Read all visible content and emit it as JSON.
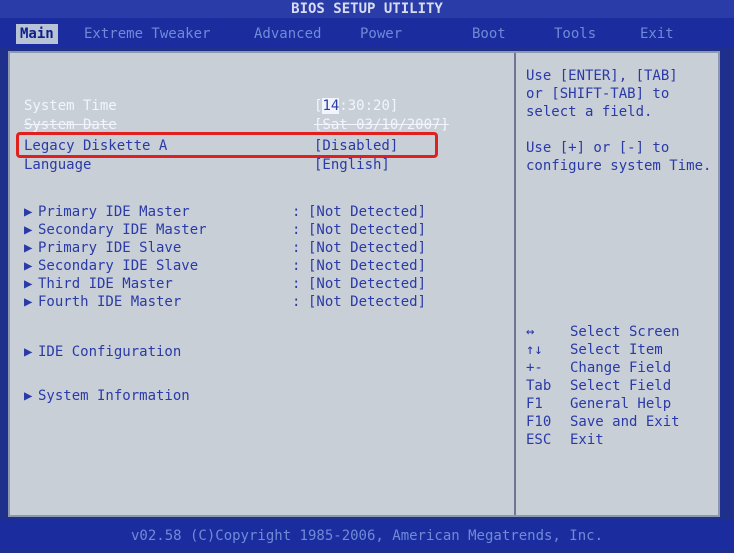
{
  "title": "BIOS SETUP UTILITY",
  "menu": [
    {
      "label": "Main"
    },
    {
      "label": "Extreme Tweaker"
    },
    {
      "label": "Advanced"
    },
    {
      "label": "Power"
    },
    {
      "label": "Boot"
    },
    {
      "label": "Tools"
    },
    {
      "label": "Exit"
    }
  ],
  "settings": [
    {
      "label": "System Time",
      "value_prefix": "[",
      "value_highlight": "14",
      "value_suffix": ":30:20]"
    },
    {
      "label": "System Date",
      "value": "[Sat 03/10/2007]"
    },
    {
      "label": "Legacy Diskette A",
      "value": "[Disabled]"
    },
    {
      "label": "Language",
      "value": "[English]"
    }
  ],
  "submenus": [
    {
      "label": "Primary IDE Master",
      "sep": ":",
      "value": "[Not Detected]"
    },
    {
      "label": "Secondary IDE Master",
      "sep": ":",
      "value": "[Not Detected]"
    },
    {
      "label": "Primary IDE Slave",
      "sep": ":",
      "value": "[Not Detected]"
    },
    {
      "label": "Secondary IDE Slave",
      "sep": ":",
      "value": "[Not Detected]"
    },
    {
      "label": "Third IDE Master",
      "sep": ":",
      "value": "[Not Detected]"
    },
    {
      "label": "Fourth IDE Master",
      "sep": ":",
      "value": "[Not Detected]"
    }
  ],
  "groups": [
    {
      "label": "IDE Configuration"
    },
    {
      "label": "System Information"
    }
  ],
  "help": [
    "Use [ENTER], [TAB]",
    "or [SHIFT-TAB] to",
    "select a field.",
    "",
    "Use [+] or [-] to",
    "configure system Time."
  ],
  "keys": [
    {
      "key": "↔",
      "desc": "Select Screen"
    },
    {
      "key": "↑↓",
      "desc": "Select Item"
    },
    {
      "key": "+-",
      "desc": "Change Field"
    },
    {
      "key": "Tab",
      "desc": "Select Field"
    },
    {
      "key": "F1",
      "desc": "General Help"
    },
    {
      "key": "F10",
      "desc": "Save and Exit"
    },
    {
      "key": "ESC",
      "desc": "Exit"
    }
  ],
  "footer": "v02.58 (C)Copyright 1985-2006, American Megatrends, Inc.",
  "colors": {
    "background": "#1f2f8c",
    "panel": "#c9cfd7",
    "text": "#2a3aa7",
    "highlight": "#e0201e"
  }
}
